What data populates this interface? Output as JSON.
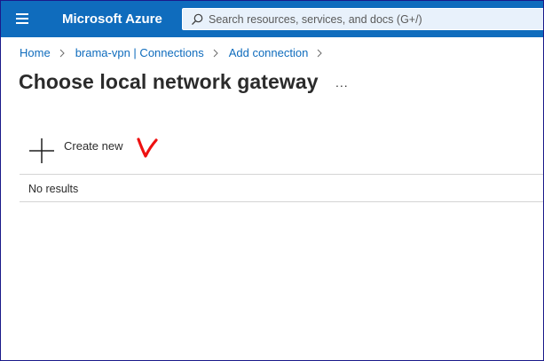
{
  "header": {
    "brand": "Microsoft Azure",
    "menu_icon": "hamburger-menu-icon",
    "search_placeholder": "Search resources, services, and docs (G+/)",
    "search_icon": "search-icon",
    "colors": {
      "bar": "#0f6cbd",
      "search_bg": "#e8f1fb"
    }
  },
  "breadcrumb": {
    "items": [
      {
        "label": "Home"
      },
      {
        "label": "brama-vpn | Connections"
      },
      {
        "label": "Add connection"
      }
    ],
    "separator_icon": "chevron-right-icon"
  },
  "page": {
    "title": "Choose local network gateway",
    "more_label": "..."
  },
  "toolbar": {
    "create_label": "Create new",
    "create_icon": "plus-icon"
  },
  "annotation": {
    "mark": "red-checkmark-annotation",
    "color": "#ee1111"
  },
  "results": {
    "empty_text": "No results"
  }
}
